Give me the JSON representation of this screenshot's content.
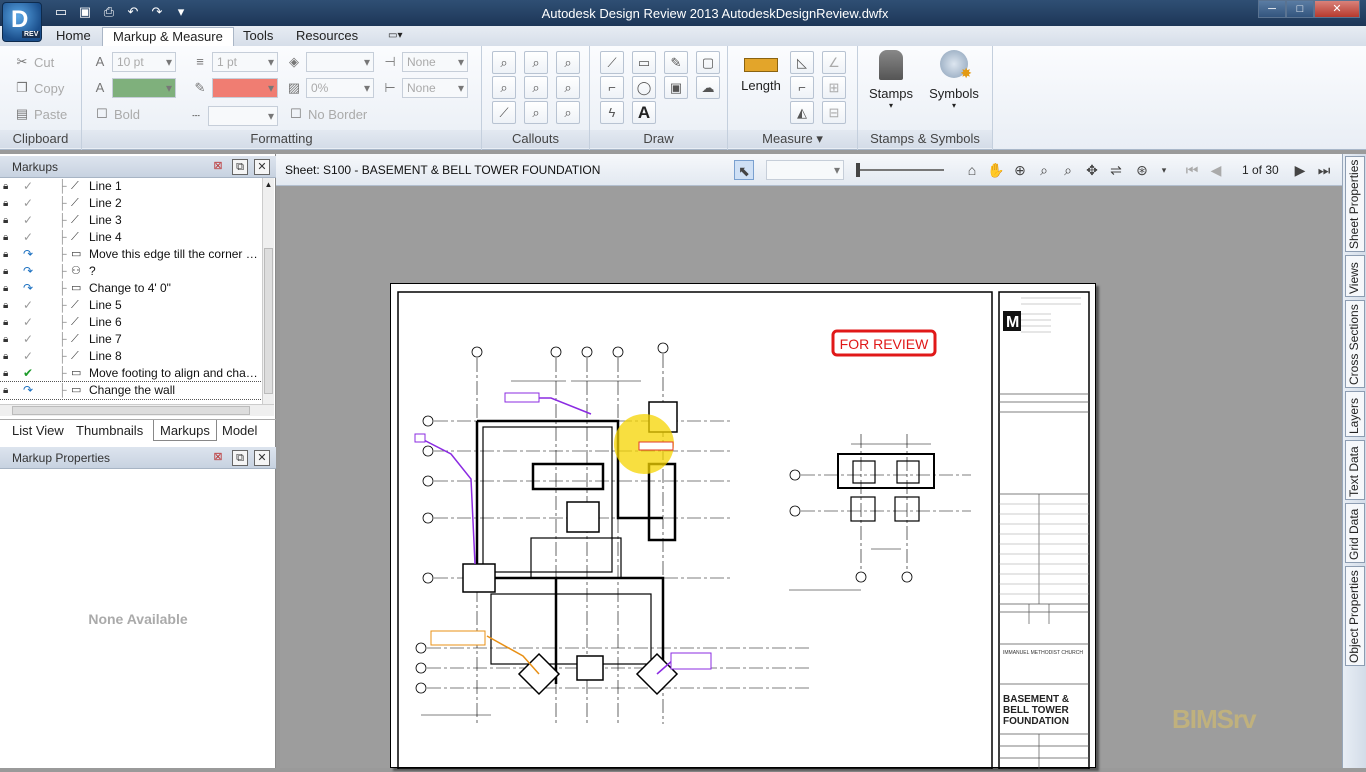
{
  "window": {
    "title": "Autodesk Design Review 2013   AutodeskDesignReview.dwfx",
    "app_button_letter": "D",
    "app_button_badge": "REV",
    "min": "─",
    "max": "□",
    "close": "✕"
  },
  "tabs": [
    {
      "label": "Home"
    },
    {
      "label": "Markup & Measure"
    },
    {
      "label": "Tools"
    },
    {
      "label": "Resources"
    }
  ],
  "ribbon": {
    "clipboard": {
      "label": "Clipboard",
      "cut": "Cut",
      "copy": "Copy",
      "paste": "Paste"
    },
    "formatting": {
      "label": "Formatting",
      "font_size": "10 pt",
      "line_width": "1 pt",
      "bold": "Bold",
      "transparency": "0%",
      "none1": "None",
      "none2": "None",
      "no_border": "No Border",
      "fill_color": "#7fb07c",
      "line_color": "#f07d72"
    },
    "callouts": {
      "label": "Callouts"
    },
    "draw": {
      "label": "Draw",
      "text_tool": "A"
    },
    "measure": {
      "label": "Measure",
      "length": "Length"
    },
    "stamps": {
      "label": "Stamps & Symbols",
      "stamps": "Stamps",
      "symbols": "Symbols"
    }
  },
  "markups_panel": {
    "title": "Markups",
    "items": [
      {
        "label": "Line 1",
        "status": "✓",
        "status_color": "#999",
        "type": "⟋"
      },
      {
        "label": "Line 2",
        "status": "✓",
        "status_color": "#999",
        "type": "⟋"
      },
      {
        "label": "Line 3",
        "status": "✓",
        "status_color": "#999",
        "type": "⟋"
      },
      {
        "label": "Line 4",
        "status": "✓",
        "status_color": "#999",
        "type": "⟋"
      },
      {
        "label": "Move this edge till the corner of ...",
        "status": "↷",
        "status_color": "#1a6fc0",
        "type": "▭"
      },
      {
        "label": "?",
        "status": "↷",
        "status_color": "#1a6fc0",
        "type": "⚇"
      },
      {
        "label": "Change to 4' 0\"",
        "status": "↷",
        "status_color": "#1a6fc0",
        "type": "▭"
      },
      {
        "label": "Line 5",
        "status": "✓",
        "status_color": "#999",
        "type": "⟋"
      },
      {
        "label": "Line 6",
        "status": "✓",
        "status_color": "#999",
        "type": "⟋"
      },
      {
        "label": "Line 7",
        "status": "✓",
        "status_color": "#999",
        "type": "⟋"
      },
      {
        "label": "Line 8",
        "status": "✓",
        "status_color": "#999",
        "type": "⟋"
      },
      {
        "label": "Move footing to align and chan...",
        "status": "✔",
        "status_color": "#1d9b2a",
        "type": "▭"
      },
      {
        "label": "Change the wall",
        "status": "↷",
        "status_color": "#1a6fc0",
        "type": "▭"
      }
    ]
  },
  "panel_tabs": [
    {
      "label": "List View"
    },
    {
      "label": "Thumbnails"
    },
    {
      "label": "Markups"
    },
    {
      "label": "Model"
    }
  ],
  "properties_panel": {
    "title": "Markup Properties",
    "empty_text": "None Available"
  },
  "viewer": {
    "sheet_title": "Sheet: S100 - BASEMENT & BELL TOWER FOUNDATION",
    "page_indicator": "1 of 30"
  },
  "drawing": {
    "stamp": "FOR REVIEW",
    "title_block": {
      "firm_logo": "M",
      "project": "IMMANUEL METHODIST CHURCH",
      "sheet_name_1": "BASEMENT &",
      "sheet_name_2": "BELL TOWER",
      "sheet_name_3": "FOUNDATION"
    }
  },
  "right_tabs": [
    {
      "label": "Sheet Properties"
    },
    {
      "label": "Views"
    },
    {
      "label": "Cross Sections"
    },
    {
      "label": "Layers"
    },
    {
      "label": "Text Data"
    },
    {
      "label": "Grid Data"
    },
    {
      "label": "Object Properties"
    }
  ],
  "watermark": "BIMSrv"
}
